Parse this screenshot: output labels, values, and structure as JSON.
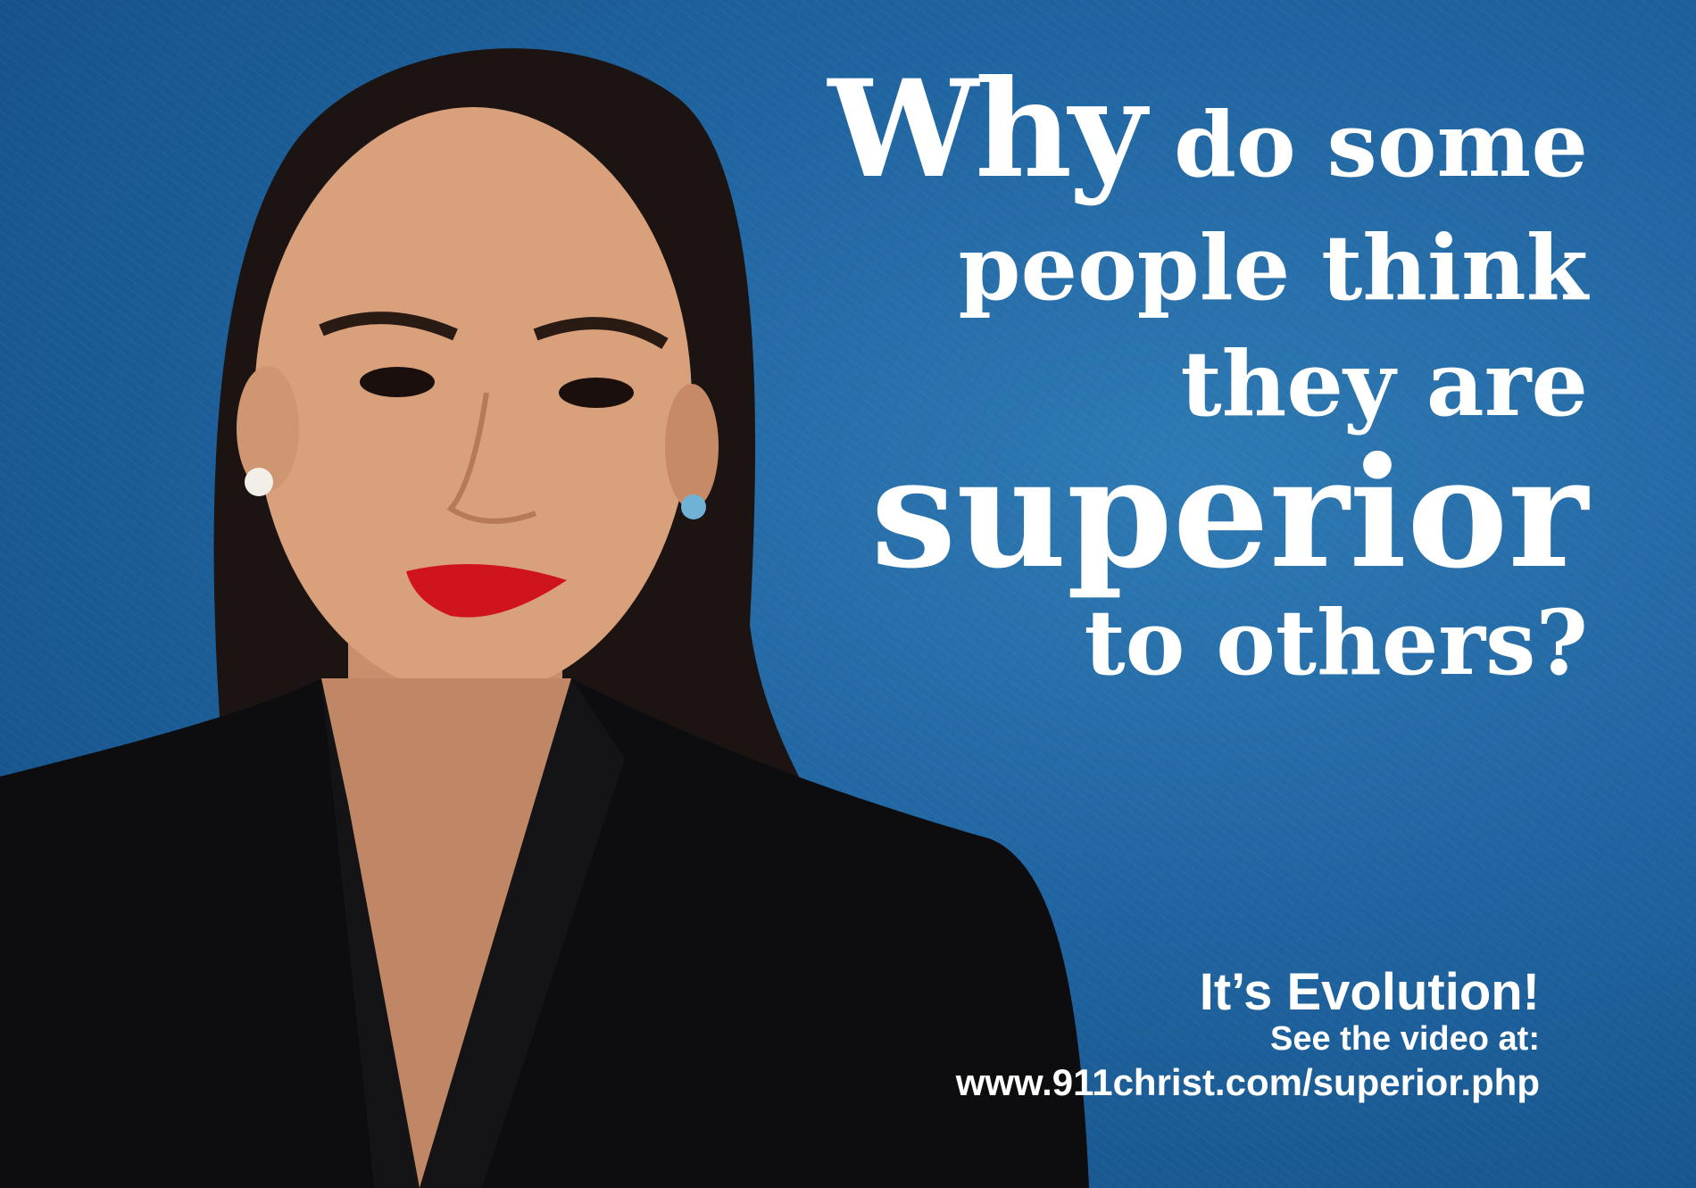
{
  "headline": {
    "word1": "Why",
    "line1_rest": "do some",
    "line2": "people think",
    "line3": "they are",
    "line4": "superior",
    "line5": "to others?"
  },
  "footer": {
    "tagline": "It’s Evolution!",
    "video_prompt": "See the video at:",
    "url": "www.911christ.com/superior.php"
  },
  "colors": {
    "background": "#1f64a0",
    "text": "#ffffff",
    "lips": "#d0141c",
    "jacket": "#0d0d0f"
  }
}
